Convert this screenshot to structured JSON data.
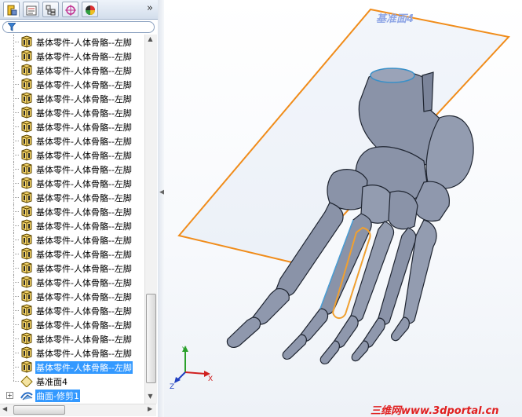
{
  "tabs": [
    {
      "name": "feature-manager",
      "icon": "feature-tree-icon"
    },
    {
      "name": "property-manager",
      "icon": "property-icon"
    },
    {
      "name": "configuration-manager",
      "icon": "configuration-icon"
    },
    {
      "name": "dimxpert-manager",
      "icon": "dimxpert-icon"
    },
    {
      "name": "display-manager",
      "icon": "appearance-icon"
    }
  ],
  "tabs_more": "»",
  "tree": {
    "part_label": "基体零件-人体骨骼--左脚",
    "part_count": 24,
    "selected_index": 23,
    "plane_item": "基准面4",
    "surface_item": "曲面-修剪1",
    "expander": "+"
  },
  "viewport": {
    "plane_label": "基准面4",
    "triad": {
      "x": "X",
      "y": "Y",
      "z": "Z"
    },
    "colors": {
      "plane": "#f08c1a",
      "bone_fill": "#8a93a8",
      "bone_edge": "#1e2430",
      "highlight": "#f0a030",
      "cut_edge": "#4aa0d8"
    }
  },
  "watermark": "三维网www.3dportal.cn"
}
